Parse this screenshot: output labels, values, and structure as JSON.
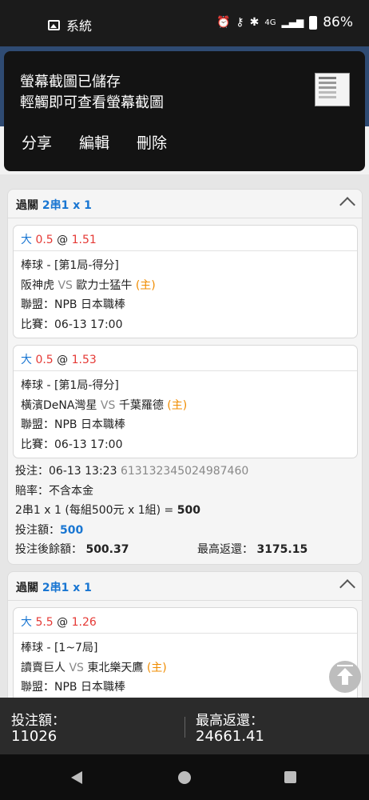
{
  "status_bar": {
    "notification_label": "系統",
    "battery": "86%",
    "icons": [
      "alarm-icon",
      "key-icon",
      "bluetooth-icon",
      "4g-icon",
      "signal-icon",
      "battery-icon"
    ]
  },
  "toast": {
    "title": "螢幕截圖已儲存",
    "subtitle": "輕觸即可查看螢幕截圖",
    "actions": {
      "share": "分享",
      "edit": "編輯",
      "delete": "刪除"
    }
  },
  "bets": [
    {
      "label": "過關",
      "combo": "2串1 x 1",
      "legs": [
        {
          "pick": "大",
          "line": "0.5",
          "at": "@",
          "odds": "1.51",
          "market": "棒球 - [第1局-得分]",
          "home": "阪神虎",
          "vs": "VS",
          "away": "歐力士猛牛",
          "host_tag": "(主)",
          "league": "聯盟：NPB 日本職棒",
          "match": "比賽：06-13 17:00"
        },
        {
          "pick": "大",
          "line": "0.5",
          "at": "@",
          "odds": "1.53",
          "market": "棒球 - [第1局-得分]",
          "home": "橫濱DeNA灣星",
          "vs": "VS",
          "away": "千葉羅德",
          "host_tag": "(主)",
          "league": "聯盟：NPB 日本職棒",
          "match": "比賽：06-13 17:00"
        }
      ],
      "summary": {
        "bet_time_label": "投注：06-13 13:23",
        "bet_id": "613132345024987460",
        "odds_type": "賠率：不含本金",
        "formula_label": "2串1 x 1 (每組500元 x 1組) =",
        "formula_value": "500",
        "stake_label": "投注額：",
        "stake_value": "500",
        "balance_label": "投注後餘額：",
        "balance_value": "500.37",
        "max_return_label": "最高返還：",
        "max_return_value": "3175.15"
      }
    },
    {
      "label": "過關",
      "combo": "2串1 x 1",
      "legs": [
        {
          "pick": "大",
          "line": "5.5",
          "at": "@",
          "odds": "1.26",
          "market": "棒球 - [1~7局]",
          "home": "讀賣巨人",
          "vs": "VS",
          "away": "東北樂天鷹",
          "host_tag": "(主)",
          "league": "聯盟：NPB 日本職棒"
        }
      ]
    }
  ],
  "totals": {
    "stake_label": "投注額：",
    "stake_value": "11026",
    "max_return_label": "最高返還：",
    "max_return_value": "24661.41"
  }
}
